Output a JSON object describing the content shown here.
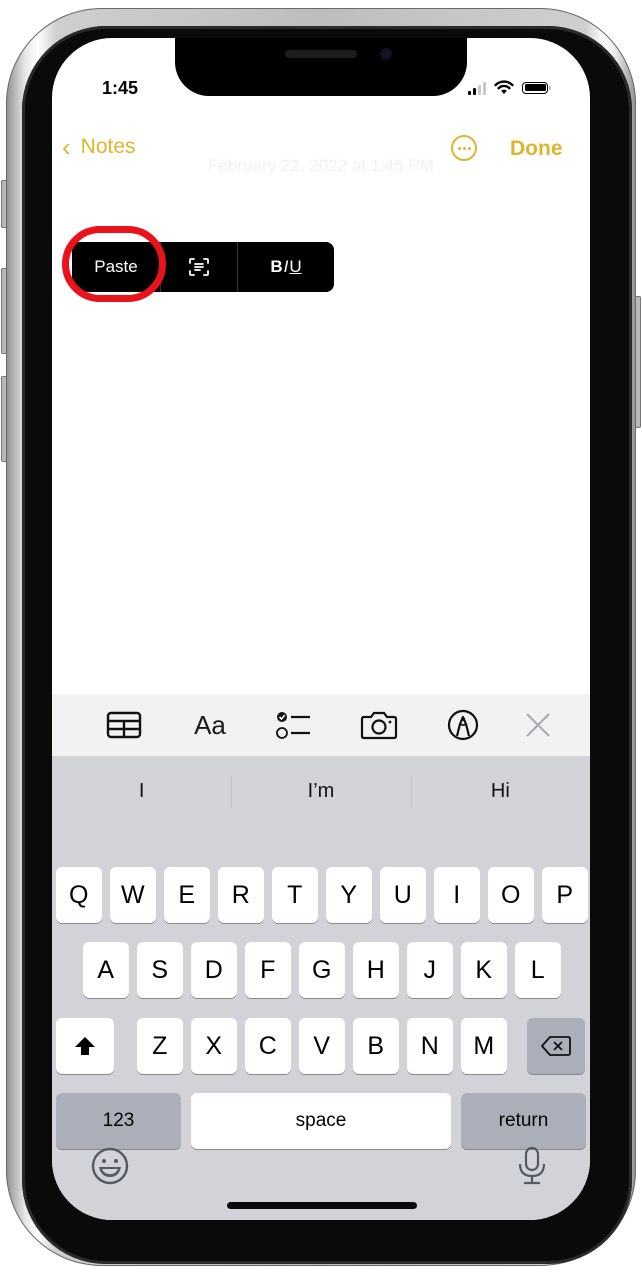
{
  "status_bar": {
    "time": "1:45",
    "signal_bars_active": 2,
    "signal_bars_total": 4,
    "battery_level_percent": 100
  },
  "nav": {
    "back_label": "Notes",
    "done_label": "Done",
    "accent_color": "#dfb52c"
  },
  "note": {
    "date_text": "February 22, 2022 at 1:45 PM"
  },
  "edit_menu": {
    "paste_label": "Paste",
    "scan_text_icon": "scan-text-icon",
    "format_label": {
      "bold": "B",
      "italic": "I",
      "underline": "U"
    },
    "highlight_ring_color": "#e8131b"
  },
  "toolbar": {
    "icons": [
      "table-icon",
      "text-format-icon",
      "checklist-icon",
      "camera-icon",
      "markup-pen-icon",
      "close-icon"
    ],
    "text_format_label": "Aa"
  },
  "keyboard": {
    "suggestions": [
      "I",
      "I’m",
      "Hi"
    ],
    "row1": [
      "Q",
      "W",
      "E",
      "R",
      "T",
      "Y",
      "U",
      "I",
      "O",
      "P"
    ],
    "row2": [
      "A",
      "S",
      "D",
      "F",
      "G",
      "H",
      "J",
      "K",
      "L"
    ],
    "row3": [
      "Z",
      "X",
      "C",
      "V",
      "B",
      "N",
      "M"
    ],
    "numbers_label": "123",
    "space_label": "space",
    "return_label": "return"
  }
}
